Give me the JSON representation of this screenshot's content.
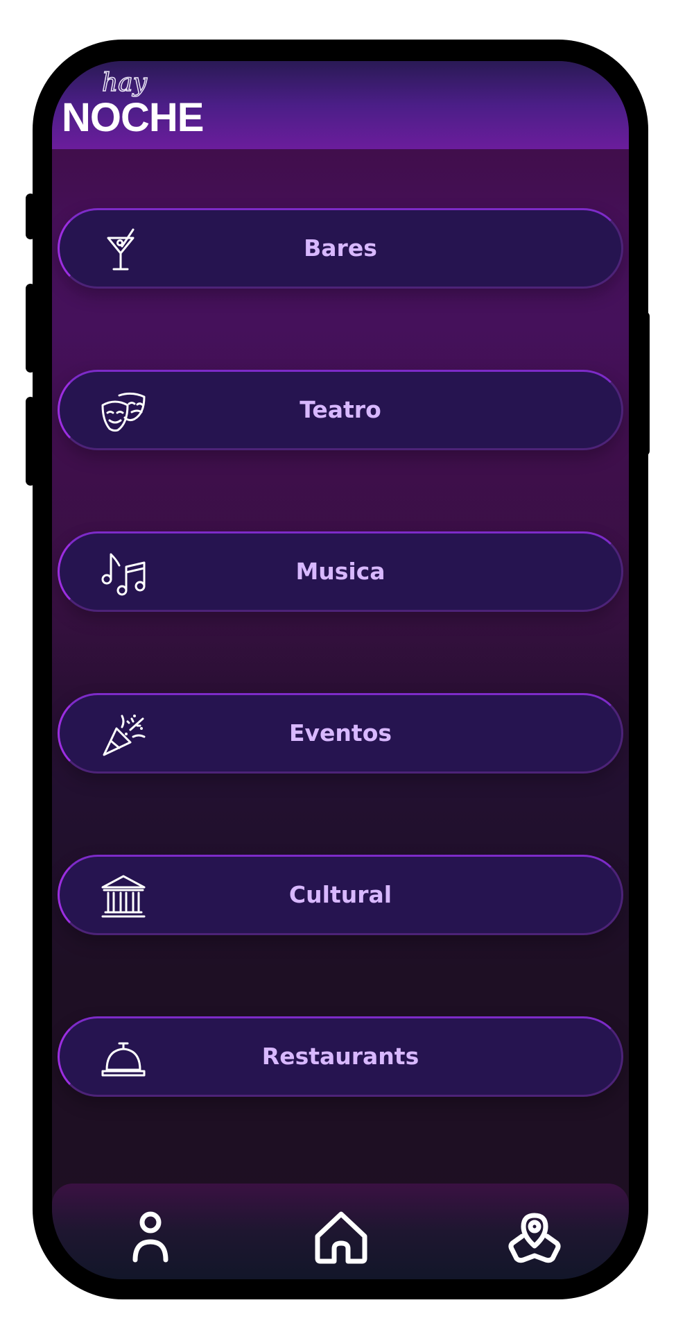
{
  "app": {
    "logo_script": "hay",
    "logo_main": "NOCHE"
  },
  "categories": [
    {
      "label": "Bares",
      "icon": "cocktail-icon"
    },
    {
      "label": "Teatro",
      "icon": "theater-masks-icon"
    },
    {
      "label": "Musica",
      "icon": "music-notes-icon"
    },
    {
      "label": "Eventos",
      "icon": "party-popper-icon"
    },
    {
      "label": "Cultural",
      "icon": "museum-icon"
    },
    {
      "label": "Restaurants",
      "icon": "service-bell-icon"
    }
  ],
  "bottom_nav": [
    {
      "icon": "user-icon"
    },
    {
      "icon": "home-icon"
    },
    {
      "icon": "map-pin-icon"
    }
  ],
  "colors": {
    "label": "#d8b8ff",
    "pill_bg": "#261450",
    "pill_border_accent": "#9b2ee0",
    "header": "#6b1d9c"
  }
}
